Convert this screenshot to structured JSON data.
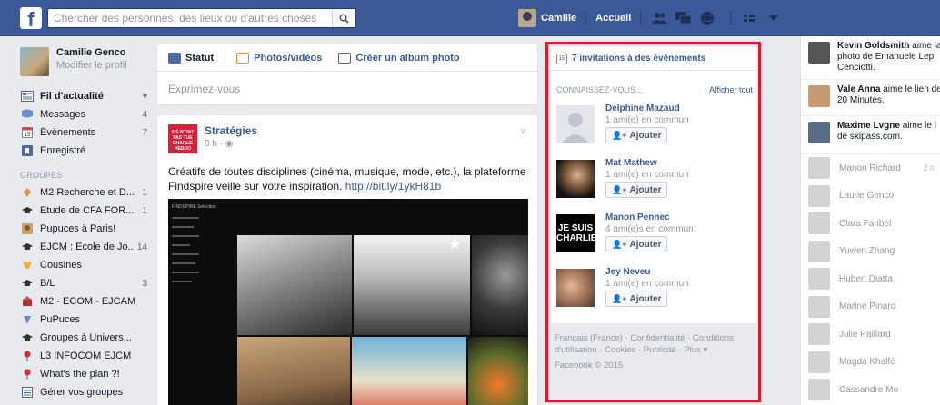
{
  "search": {
    "placeholder": "Chercher des personnes, des lieux ou d'autres choses"
  },
  "topnav": {
    "user_name": "Camille",
    "home": "Accueil"
  },
  "profile": {
    "name": "Camille Genco",
    "edit": "Modifier le profil"
  },
  "left_nav": [
    {
      "label": "Fil d'actualité",
      "count": "",
      "icon": "news-feed-icon",
      "bold": true,
      "caret": "▾"
    },
    {
      "label": "Messages",
      "count": "4",
      "icon": "messages-icon"
    },
    {
      "label": "Évènements",
      "count": "7",
      "icon": "calendar-icon"
    },
    {
      "label": "Enregistré",
      "count": "",
      "icon": "bookmark-icon"
    }
  ],
  "groups_title": "GROUPES",
  "groups": [
    {
      "label": "M2 Recherche et D...",
      "count": "1"
    },
    {
      "label": "Etude de CFA FOR...",
      "count": "1"
    },
    {
      "label": "Pupuces à Paris!",
      "count": ""
    },
    {
      "label": "EJCM : Ecole de Jo...",
      "count": "14"
    },
    {
      "label": "Cousines",
      "count": ""
    },
    {
      "label": "B/L",
      "count": "3"
    },
    {
      "label": "M2 - ECOM - EJCAM",
      "count": ""
    },
    {
      "label": "PuPuces",
      "count": ""
    },
    {
      "label": "Groupes à Univers...",
      "count": ""
    },
    {
      "label": "L3 INFOCOM EJCM",
      "count": ""
    },
    {
      "label": "What's the plan ?!",
      "count": ""
    },
    {
      "label": "Gérer vos groupes",
      "count": ""
    }
  ],
  "composer": {
    "tab_status": "Statut",
    "tab_photos": "Photos/vidéos",
    "tab_album": "Créer un album photo",
    "prompt": "Exprimez-vous"
  },
  "post": {
    "page_name": "Stratégies",
    "time": "8 h · ◉",
    "logo_text": "ILS N'ONT PAS TUE CHARLIE HEBDO",
    "text": "Créatifs de toutes disciplines (cinéma, musique, mode, etc.), la plateforme Findspire veille sur votre inspiration.",
    "link": "http://bit.ly/1ykH81b",
    "image_brand": "FINDSPIRE Selection"
  },
  "right": {
    "events_label": "7 invitations à des événements",
    "pymk_title": "CONNAISSEZ-VOUS...",
    "see_all": "Afficher tout",
    "add_label": "Ajouter",
    "people": [
      {
        "name": "Delphine Mazaud",
        "mutual": "1 ami(e) en commun"
      },
      {
        "name": "Mat Mathew",
        "mutual": "1 ami(e) en commun"
      },
      {
        "name": "Manon Pennec",
        "mutual": "4 ami(e)s en commun"
      },
      {
        "name": "Jey Neveu",
        "mutual": "1 ami(e) en commun"
      }
    ],
    "charlie_text": "JE SUIS CHARLIE",
    "footer_links": "Français (France) · Confidentialité · Conditions d'utilisation · Cookies · Publicité · Plus ▾",
    "footer_copy": "Facebook © 2015"
  },
  "ticker": [
    {
      "name": "Kevin Goldsmith",
      "text": " aime la photo de Emanuele Lep Cenciotti."
    },
    {
      "name": "Vale Anna",
      "text": " aime le lien de 20 Minutes."
    },
    {
      "name": "Maxime Lvgne",
      "text": " aime le l de skipass.com."
    }
  ],
  "chat": [
    {
      "name": "Manon Richard",
      "status": "2 h"
    },
    {
      "name": "Laurie Genco",
      "status": ""
    },
    {
      "name": "Clara Faribel",
      "status": ""
    },
    {
      "name": "Yuwen Zhang",
      "status": ""
    },
    {
      "name": "Hubert Diatta",
      "status": ""
    },
    {
      "name": "Marine Pinard",
      "status": ""
    },
    {
      "name": "Julie Paillard",
      "status": ""
    },
    {
      "name": "Magda Khalfé",
      "status": ""
    },
    {
      "name": "Cassandre Mo",
      "status": ""
    }
  ],
  "colors": {
    "brand": "#3b5998",
    "highlight": "#d61d2d"
  }
}
